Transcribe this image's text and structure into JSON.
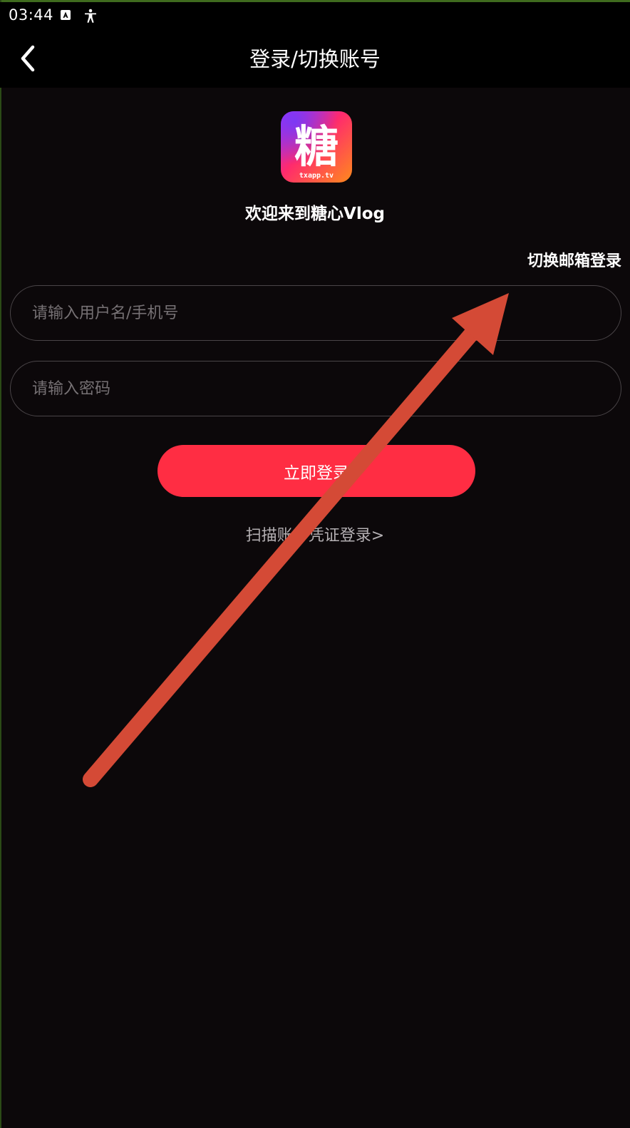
{
  "status_bar": {
    "time": "03:44",
    "icons": [
      "accessibility-a-icon",
      "accessibility-person-icon"
    ]
  },
  "header": {
    "back_icon": "chevron-left-icon",
    "title": "登录/切换账号"
  },
  "brand": {
    "logo_char": "糖",
    "logo_subtext": "txapp.tv",
    "welcome_text": "欢迎来到糖心Vlog"
  },
  "form": {
    "switch_email_label": "切换邮箱登录",
    "username_placeholder": "请输入用户名/手机号",
    "username_value": "",
    "password_placeholder": "请输入密码",
    "password_value": "",
    "login_button_label": "立即登录",
    "scan_link_label": "扫描账号凭证登录>"
  },
  "colors": {
    "background": "#0c080a",
    "bar_background": "#000000",
    "accent": "#ff2d43",
    "input_border": "#4a4548",
    "placeholder": "#767174",
    "annotation_arrow": "#d44a36"
  }
}
